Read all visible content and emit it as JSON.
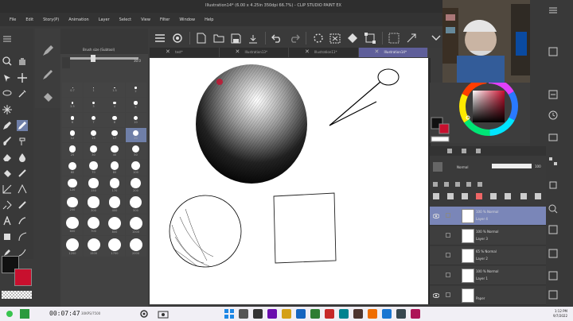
{
  "window": {
    "title": "Illustration14* (6.00 x 4.25in 350dpi 66.7%) - CLIP STUDIO PAINT EX",
    "minimize": "–",
    "maximize": "□",
    "close": "✕"
  },
  "menu": [
    "File",
    "Edit",
    "Story(P)",
    "Animation",
    "Layer",
    "Select",
    "View",
    "Filter",
    "Window",
    "Help"
  ],
  "tabs": [
    {
      "label": "test*",
      "close": "✕"
    },
    {
      "label": "Illustration13*",
      "close": "✕"
    },
    {
      "label": "Illustration11*",
      "close": "✕"
    },
    {
      "label": "Illustration14*",
      "close": "✕"
    }
  ],
  "brush": {
    "name": "Brush size (Subtool)",
    "size_value": "30.0",
    "grid_labels": [
      "0.7",
      "1",
      "1.5",
      "2",
      "2.5",
      "3",
      "4",
      "5",
      "6",
      "7",
      "8",
      "10",
      "12",
      "15",
      "17",
      "20",
      "25",
      "30",
      "40",
      "50",
      "60",
      "70",
      "80",
      "100",
      "120",
      "150",
      "170",
      "200",
      "250",
      "300",
      "400",
      "500",
      "600",
      "700",
      "800",
      "1000",
      "1200",
      "1500",
      "1700",
      "2000"
    ],
    "selected_index": 15
  },
  "layers": {
    "blend_mode": "Normal",
    "opacity": "100",
    "rows": [
      {
        "mode": "100 % Normal",
        "name": "Layer 4",
        "selected": true,
        "visible": true
      },
      {
        "mode": "100 % Normal",
        "name": "Layer 3",
        "selected": false,
        "visible": false
      },
      {
        "mode": "65 % Normal",
        "name": "Layer 2",
        "selected": false,
        "visible": false
      },
      {
        "mode": "100 % Normal",
        "name": "Layer 1",
        "selected": false,
        "visible": false
      },
      {
        "mode": "",
        "name": "Paper",
        "selected": false,
        "visible": true
      }
    ]
  },
  "taskbar": {
    "timer": "00:07:47",
    "stats": "30KPS/7500",
    "clock_time": "1:12 PM",
    "clock_date": "9/7/2022"
  },
  "colors": {
    "main": "#111111",
    "sub": "#c8102e",
    "accent": "#6f7fa8"
  }
}
